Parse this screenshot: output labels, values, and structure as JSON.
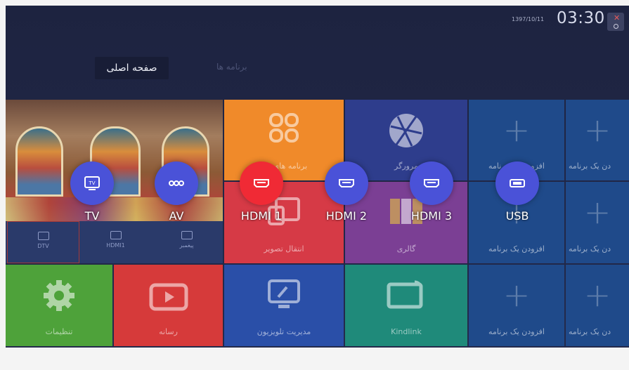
{
  "status_bar": {
    "date": "1397/10/11",
    "time": "03:30"
  },
  "tabs": {
    "home": "صفحه اصلی",
    "apps": "برنامه ها"
  },
  "tiles": {
    "apps": "برنامه های من",
    "browser": "مرورگر",
    "add_app": "افزودن یک برنامه",
    "add_app_cut": "دن یک برنامه",
    "screen_share": "انتقال تصویر",
    "gallery": "گالری",
    "settings": "تنظیمات",
    "media": "رسانه",
    "tv_manager": "مدیریت تلویزیون",
    "kindlink": "Kindlink"
  },
  "input_strip": {
    "dtv": "DTV",
    "hdmi1": "HDMI1",
    "messenger": "پیغمبر"
  },
  "sources": [
    "TV",
    "AV",
    "HDMI 1",
    "HDMI 2",
    "HDMI 3",
    "USB"
  ],
  "colors": {
    "background": "#1f2440",
    "apps_tile": "#f08a2a",
    "browser_tile": "#2e3d8c",
    "add_tile": "#1f4a8a",
    "screen_share_tile": "#d63a46",
    "gallery_tile": "#7b3f94",
    "settings_tile": "#4ea23a",
    "media_tile": "#d63a3a",
    "tv_manager_tile": "#2a4fa8",
    "kindlink_tile": "#1f8a7a",
    "source_bubble": "#4a52d8",
    "source_bubble_active": "#f02a35"
  }
}
